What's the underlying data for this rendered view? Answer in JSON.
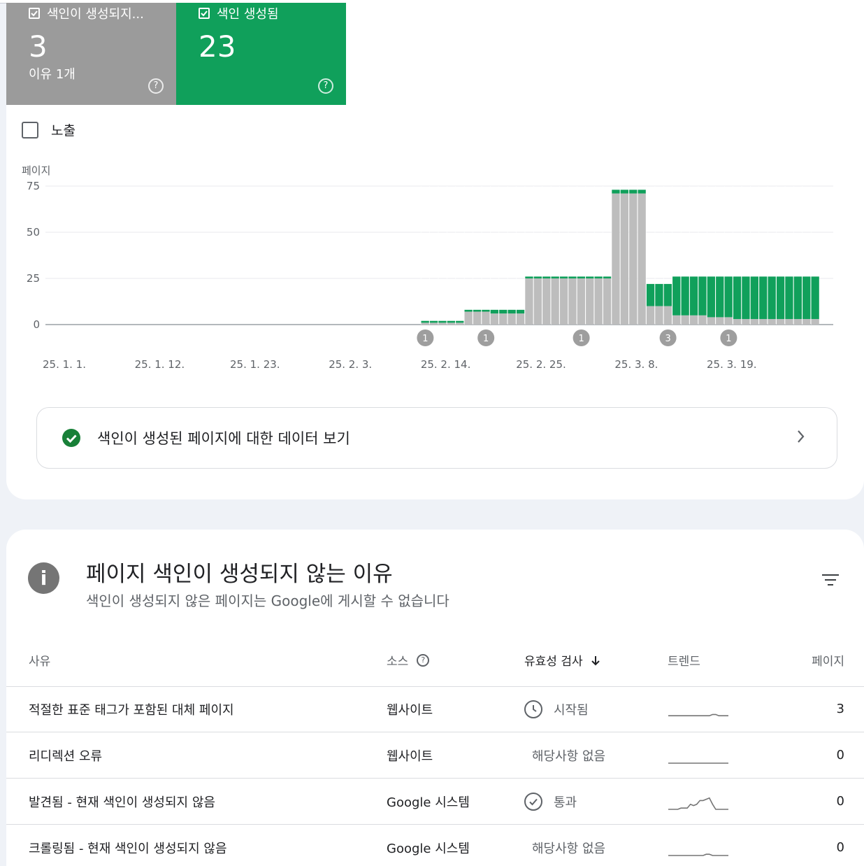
{
  "summary": {
    "not_indexed": {
      "label": "색인이 생성되지...",
      "count": "3",
      "sub": "이유 1개",
      "help": "?"
    },
    "indexed": {
      "label": "색인 생성됨",
      "count": "23",
      "help": "?"
    }
  },
  "impressions_label": "노출",
  "colors": {
    "not_indexed": "#bdbdbd",
    "indexed": "#10a05b",
    "annotation": "#9e9e9e"
  },
  "chart_data": {
    "type": "bar",
    "stacked": true,
    "ylabel": "페이지",
    "ylim": [
      0,
      75
    ],
    "yticks": [
      0,
      25,
      50,
      75
    ],
    "x_tick_labels": [
      "25. 1. 1.",
      "25. 1. 12.",
      "25. 1. 23.",
      "25. 2. 3.",
      "25. 2. 14.",
      "25. 2. 25.",
      "25. 3. 8.",
      "25. 3. 19."
    ],
    "x_start": "2025-01-01",
    "x_end": "2025-03-29",
    "series": [
      {
        "name": "색인이 생성되지 않음",
        "color": "#bdbdbd",
        "values": [
          0,
          0,
          0,
          0,
          0,
          0,
          0,
          0,
          0,
          0,
          0,
          0,
          0,
          0,
          0,
          0,
          0,
          0,
          0,
          0,
          0,
          0,
          0,
          0,
          0,
          0,
          0,
          0,
          0,
          0,
          0,
          0,
          0,
          0,
          0,
          0,
          0,
          0,
          0,
          0,
          0,
          0,
          0,
          1,
          1,
          1,
          1,
          1,
          7,
          7,
          7,
          6,
          6,
          6,
          6,
          25,
          25,
          25,
          25,
          25,
          25,
          25,
          25,
          25,
          25,
          71,
          71,
          71,
          71,
          10,
          10,
          10,
          5,
          5,
          5,
          5,
          4,
          4,
          4,
          3,
          3,
          3,
          3,
          3,
          3,
          3,
          3,
          3,
          3
        ]
      },
      {
        "name": "색인 생성됨",
        "color": "#10a05b",
        "values": [
          0,
          0,
          0,
          0,
          0,
          0,
          0,
          0,
          0,
          0,
          0,
          0,
          0,
          0,
          0,
          0,
          0,
          0,
          0,
          0,
          0,
          0,
          0,
          0,
          0,
          0,
          0,
          0,
          0,
          0,
          0,
          0,
          0,
          0,
          0,
          0,
          0,
          0,
          0,
          0,
          0,
          0,
          0,
          1,
          1,
          1,
          1,
          1,
          1,
          1,
          1,
          2,
          2,
          2,
          2,
          1,
          1,
          1,
          1,
          1,
          1,
          1,
          1,
          1,
          1,
          2,
          2,
          2,
          2,
          12,
          12,
          12,
          21,
          21,
          21,
          21,
          22,
          22,
          22,
          23,
          23,
          23,
          23,
          23,
          23,
          23,
          23,
          23,
          23
        ]
      }
    ],
    "annotations": [
      {
        "date": "2025-02-13",
        "label": "1"
      },
      {
        "date": "2025-02-20",
        "label": "1"
      },
      {
        "date": "2025-03-03",
        "label": "1"
      },
      {
        "date": "2025-03-13",
        "label": "3"
      },
      {
        "date": "2025-03-20",
        "label": "1"
      }
    ],
    "grid": true
  },
  "view_indexed": {
    "label": "색인이 생성된 페이지에 대한 데이터 보기"
  },
  "reasons": {
    "title": "페이지 색인이 생성되지 않는 이유",
    "subtitle": "색인이 생성되지 않은 페이지는 Google에 게시할 수 없습니다",
    "columns": {
      "reason": "사유",
      "source": "소스",
      "validation": "유효성 검사",
      "trend": "트렌드",
      "pages": "페이지"
    },
    "rows": [
      {
        "reason": "적절한 표준 태그가 포함된 대체 페이지",
        "source": "웹사이트",
        "validation": "시작됨",
        "validation_icon": "clock-icon",
        "pages": "3",
        "trend": [
          1,
          1,
          1,
          1,
          1,
          1,
          1,
          1,
          1,
          1,
          1,
          1,
          1,
          1,
          2,
          2,
          1,
          1,
          1,
          1
        ]
      },
      {
        "reason": "리디렉션 오류",
        "source": "웹사이트",
        "validation": "해당사항 없음",
        "validation_icon": "",
        "pages": "0",
        "trend": [
          0,
          0,
          0,
          0,
          0,
          0,
          0,
          0,
          0,
          0,
          0,
          0,
          0,
          0,
          0,
          0,
          0,
          0,
          0,
          0
        ]
      },
      {
        "reason": "발견됨 - 현재 색인이 생성되지 않음",
        "source": "Google 시스템",
        "validation": "통과",
        "validation_icon": "check-circle-icon",
        "pages": "0",
        "trend": [
          0,
          0,
          0,
          0,
          1,
          1,
          1,
          4,
          3,
          4,
          7,
          7,
          8,
          9,
          4,
          0,
          0,
          0,
          0,
          0
        ]
      },
      {
        "reason": "크롤링됨 - 현재 색인이 생성되지 않음",
        "source": "Google 시스템",
        "validation": "해당사항 없음",
        "validation_icon": "",
        "pages": "0",
        "trend": [
          0,
          0,
          0,
          0,
          0,
          0,
          0,
          0,
          0,
          0,
          0,
          0,
          1,
          1,
          0,
          0,
          0,
          0,
          0,
          0
        ]
      }
    ]
  }
}
